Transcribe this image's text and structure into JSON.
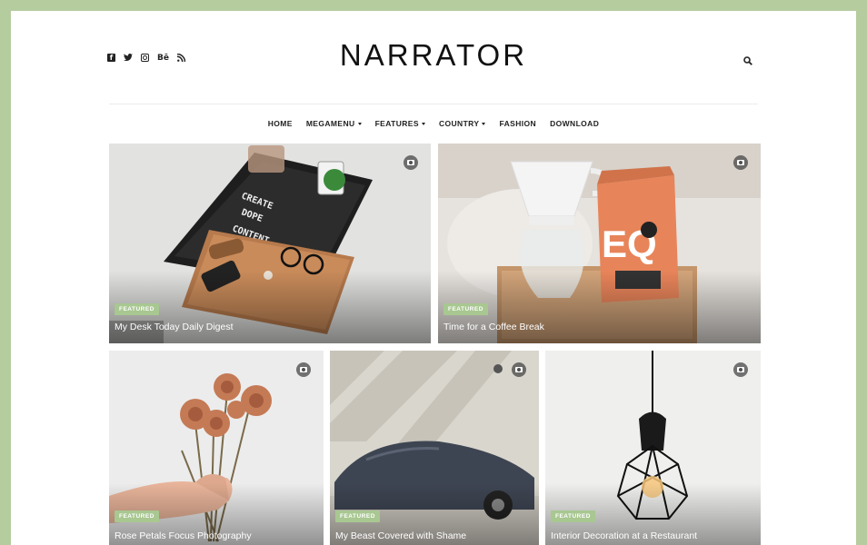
{
  "site": {
    "logo": "NARRATOR"
  },
  "socials": [
    {
      "name": "facebook",
      "glyph": "f"
    },
    {
      "name": "twitter",
      "glyph": "🐦"
    },
    {
      "name": "instagram",
      "glyph": ""
    },
    {
      "name": "behance",
      "glyph": "Bē"
    },
    {
      "name": "rss",
      "glyph": "))"
    }
  ],
  "nav": {
    "items": [
      {
        "label": "HOME",
        "dropdown": false
      },
      {
        "label": "MEGAMENU",
        "dropdown": true
      },
      {
        "label": "FEATURES",
        "dropdown": true
      },
      {
        "label": "COUNTRY",
        "dropdown": true
      },
      {
        "label": "FASHION",
        "dropdown": false
      },
      {
        "label": "DOWNLOAD",
        "dropdown": false
      }
    ]
  },
  "colors": {
    "frame": "#b5cc9f",
    "badge": "#a8c791",
    "text": "#222222"
  },
  "posts": [
    {
      "badge": "FEATURED",
      "title": "My Desk Today Daily Digest",
      "icon": "camera-icon"
    },
    {
      "badge": "FEATURED",
      "title": "Time for a Coffee Break",
      "icon": "camera-icon"
    },
    {
      "badge": "FEATURED",
      "title": "Rose Petals Focus Photography",
      "icon": "camera-icon"
    },
    {
      "badge": "FEATURED",
      "title": "My Beast Covered with Shame",
      "icon": "camera-icon"
    },
    {
      "badge": "FEATURED",
      "title": "Interior Decoration at a Restaurant",
      "icon": "camera-icon"
    }
  ]
}
